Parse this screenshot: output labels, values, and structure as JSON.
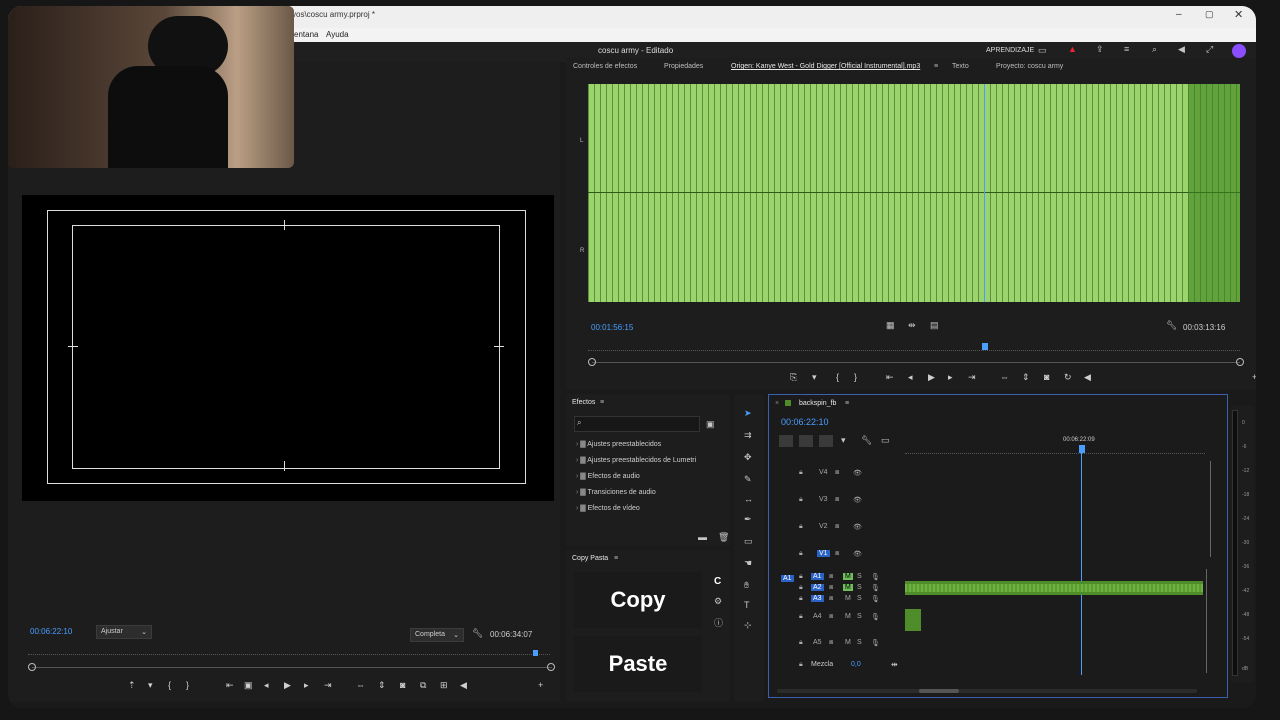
{
  "window": {
    "path_title": "vos\\coscu army.prproj *",
    "project_title": "coscu army - Editado",
    "controls": [
      "minimize-icon",
      "maximize-icon",
      "close-icon"
    ]
  },
  "menu": {
    "items": [
      "entana",
      "Ayuda"
    ]
  },
  "appbar": {
    "learn_label": "APRENDIZAJE"
  },
  "program_monitor": {
    "timecode": "00:06:22:10",
    "fit_select": "Ajustar",
    "quality_select": "Completa",
    "duration": "00:06:34:07"
  },
  "source_panel": {
    "tabs": [
      "Controles de efectos",
      "Propiedades",
      "Origen: Kanye West - Gold Digger [Official Instrumental].mp3",
      "Texto",
      "Proyecto: coscu army"
    ],
    "channel_L": "L",
    "channel_R": "R",
    "timecode_in": "00:01:56:15",
    "timecode_out": "00:03:13:16"
  },
  "effects_panel": {
    "title": "Efectos",
    "search_placeholder": "",
    "items": [
      "Ajustes preestablecidos",
      "Ajustes preestablecidos de Lumetri",
      "Efectos de audio",
      "Transiciones de audio",
      "Efectos de vídeo"
    ]
  },
  "copypaste_panel": {
    "title": "Copy Pasta",
    "copy_label": "Copy",
    "paste_label": "Paste",
    "side_icon_letter": "C"
  },
  "timeline": {
    "sequence_name": "backspin_fb",
    "timecode": "00:06:22:10",
    "ruler_label": "00:06:22:09",
    "video_tracks": [
      "V4",
      "V3",
      "V2",
      "V1"
    ],
    "audio_tracks": [
      "A1",
      "A2",
      "A3",
      "A4",
      "A5"
    ],
    "source_patch": "A1",
    "mix_label": "Mezcla",
    "mix_value": "0,0",
    "M_label": "M",
    "S_label": "S"
  },
  "meter": {
    "labels": [
      "0",
      "-6",
      "-12",
      "-18",
      "-24",
      "-30",
      "-36",
      "-42",
      "-48",
      "-54",
      "dB"
    ]
  },
  "colors": {
    "accent_blue": "#4a9eff",
    "waveform_green": "#9bd36c",
    "audio_clip_green": "#4f8d2a",
    "timeline_border": "#3d5fb0"
  }
}
